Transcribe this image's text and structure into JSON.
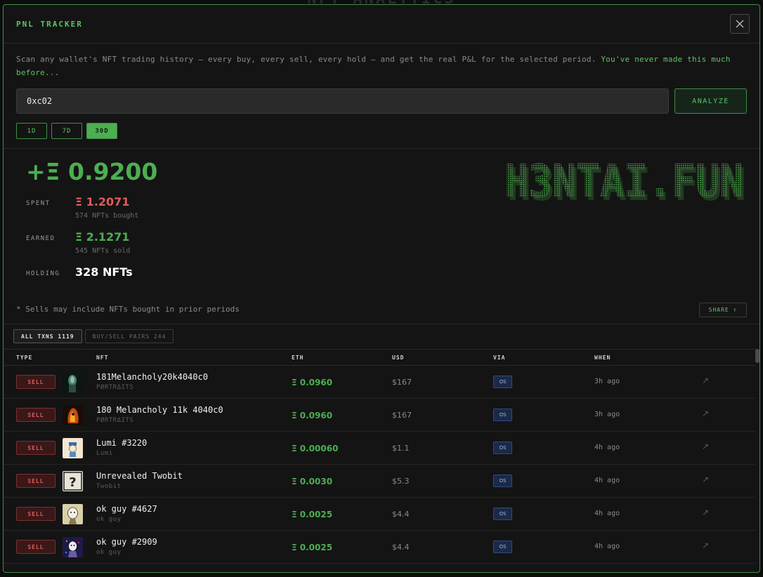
{
  "background_title": "NFT ANALYTICS",
  "header": {
    "title": "PNL TRACKER",
    "close_icon": "close-icon"
  },
  "description": {
    "text": "Scan any wallet's NFT trading history — every buy, every sell, every hold — and get the real P&L for the selected period. ",
    "highlight": "You've never made this much before..."
  },
  "search": {
    "value": "0xc02",
    "button_label": "ANALYZE"
  },
  "periods": [
    {
      "label": "1D",
      "active": false
    },
    {
      "label": "7D",
      "active": false
    },
    {
      "label": "30D",
      "active": true
    }
  ],
  "summary": {
    "pnl": "+Ξ 0.9200",
    "spent": {
      "label": "SPENT",
      "value": "Ξ 1.2071",
      "sub": "574 NFTs bought"
    },
    "earned": {
      "label": "EARNED",
      "value": "Ξ 2.1271",
      "sub": "545 NFTs sold"
    },
    "holding": {
      "label": "HOLDING",
      "value": "328 NFTs"
    }
  },
  "logo_text": "H3NTAI.FUN",
  "note": "* Sells may include NFTs bought in prior periods",
  "share_label": "SHARE ↑",
  "tabs": [
    {
      "label": "ALL TXNS 1119",
      "active": true
    },
    {
      "label": "BUY/SELL PAIRS 244",
      "active": false
    }
  ],
  "table": {
    "headers": {
      "type": "TYPE",
      "nft": "NFT",
      "eth": "ETH",
      "usd": "USD",
      "via": "VIA",
      "when": "WHEN"
    },
    "rows": [
      {
        "type": "SELL",
        "name": "181Melancholy20k4040c0",
        "collection": "PØRTRΔITS",
        "eth": "Ξ 0.0960",
        "usd": "$167",
        "via": "OS",
        "when": "3h ago",
        "thumb": "portrait-dark"
      },
      {
        "type": "SELL",
        "name": "180 Melancholy 11k 4040c0",
        "collection": "PØRTRΔITS",
        "eth": "Ξ 0.0960",
        "usd": "$167",
        "via": "OS",
        "when": "3h ago",
        "thumb": "portrait-fire"
      },
      {
        "type": "SELL",
        "name": "Lumi #3220",
        "collection": "Lumi",
        "eth": "Ξ 0.00060",
        "usd": "$1.1",
        "via": "OS",
        "when": "4h ago",
        "thumb": "lumi"
      },
      {
        "type": "SELL",
        "name": "Unrevealed Twobit",
        "collection": "Twobit",
        "eth": "Ξ 0.0030",
        "usd": "$5.3",
        "via": "OS",
        "when": "4h ago",
        "thumb": "question"
      },
      {
        "type": "SELL",
        "name": "ok guy #4627",
        "collection": "ok guy",
        "eth": "Ξ 0.0025",
        "usd": "$4.4",
        "via": "OS",
        "when": "4h ago",
        "thumb": "okguy-light"
      },
      {
        "type": "SELL",
        "name": "ok guy #2909",
        "collection": "ok guy",
        "eth": "Ξ 0.0025",
        "usd": "$4.4",
        "via": "OS",
        "when": "4h ago",
        "thumb": "okguy-dark"
      }
    ]
  }
}
